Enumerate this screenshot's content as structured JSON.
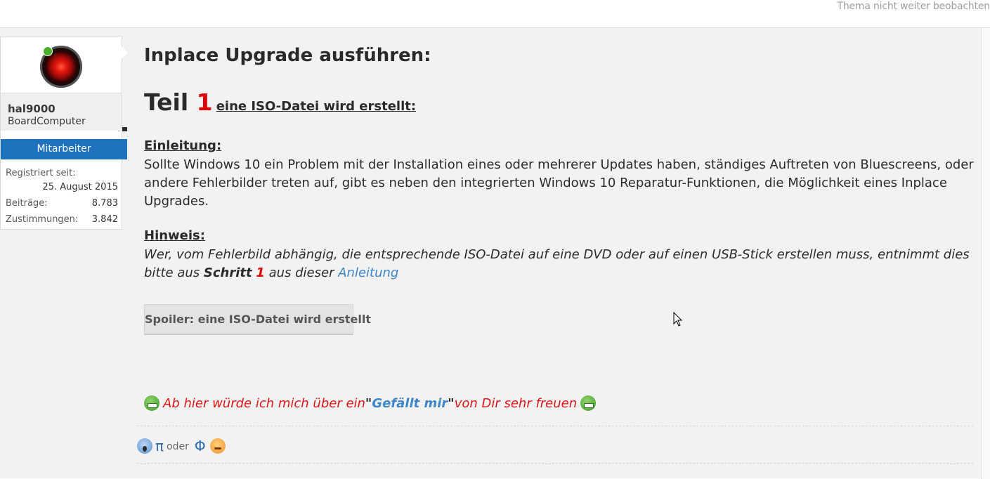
{
  "header": {
    "unwatch_label": "Thema nicht weiter beobachten"
  },
  "user": {
    "name": "hal9000",
    "title": "BoardComputer",
    "rank": "Mitarbeiter",
    "stats": [
      {
        "label": "Registriert seit:",
        "value": "25. August 2015"
      },
      {
        "label": "Beiträge:",
        "value": "8.783"
      },
      {
        "label": "Zustimmungen:",
        "value": "3.842"
      }
    ]
  },
  "post": {
    "title": "Inplace Upgrade ausführen:",
    "part_word": "Teil ",
    "part_number": "1",
    "part_subtitle": "eine ISO-Datei wird erstellt:",
    "intro_label": "Einleitung:",
    "intro_text": "Sollte Windows 10 ein Problem mit der Installation eines oder mehrerer Updates haben, ständiges Auftreten von Bluescreens, oder andere Fehlerbilder treten auf, gibt es neben den integrierten Windows 10 Reparatur-Funktionen, die Möglichkeit eines Inplace Upgrades.",
    "hint_label": "Hinweis:",
    "hint_text": "Wer, vom Fehlerbild abhängig, die entsprechende ISO-Datei auf eine DVD oder auf einen USB-Stick erstellen muss, entnimmt dies bitte aus ",
    "hint_step_word": "Schritt",
    "hint_step_number": "1",
    "hint_mid": " aus dieser ",
    "hint_link": "Anleitung",
    "spoiler_label": "Spoiler: eine ISO-Datei wird erstellt",
    "like_before": "Ab hier würde ich mich über ein ",
    "like_quote_open": "\"",
    "like_strong": "Gefällt mir",
    "like_quote_close": "\"",
    "like_after": " von Dir sehr freuen",
    "footer_pi": "π",
    "footer_oder": "oder",
    "footer_phi": "Φ"
  },
  "colors": {
    "accent_blue": "#1e73be",
    "red": "#e00000",
    "link": "#3f86c9"
  }
}
